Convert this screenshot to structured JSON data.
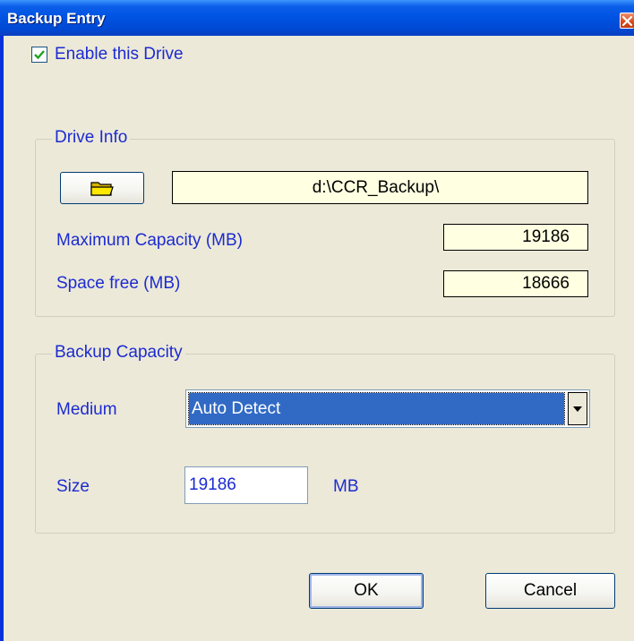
{
  "window": {
    "title": "Backup Entry",
    "colors": {
      "titlebar": "#0054e3",
      "face": "#ece9d8",
      "label_text": "#1c2bd1",
      "field_bg": "#ffffe1",
      "selection": "#316ac5"
    }
  },
  "enable_drive": {
    "label": "Enable this Drive",
    "checked": true,
    "icon": "checkmark-icon"
  },
  "drive_info": {
    "title": "Drive Info",
    "browse_icon": "folder-icon",
    "path": "d:\\CCR_Backup\\",
    "max_capacity_label": "Maximum Capacity (MB)",
    "max_capacity_value": "19186",
    "space_free_label": "Space free (MB)",
    "space_free_value": "18666"
  },
  "backup_capacity": {
    "title": "Backup Capacity",
    "medium_label": "Medium",
    "medium_value": "Auto Detect",
    "size_label": "Size",
    "size_value": "19186",
    "size_unit": "MB"
  },
  "buttons": {
    "ok": "OK",
    "cancel": "Cancel"
  }
}
